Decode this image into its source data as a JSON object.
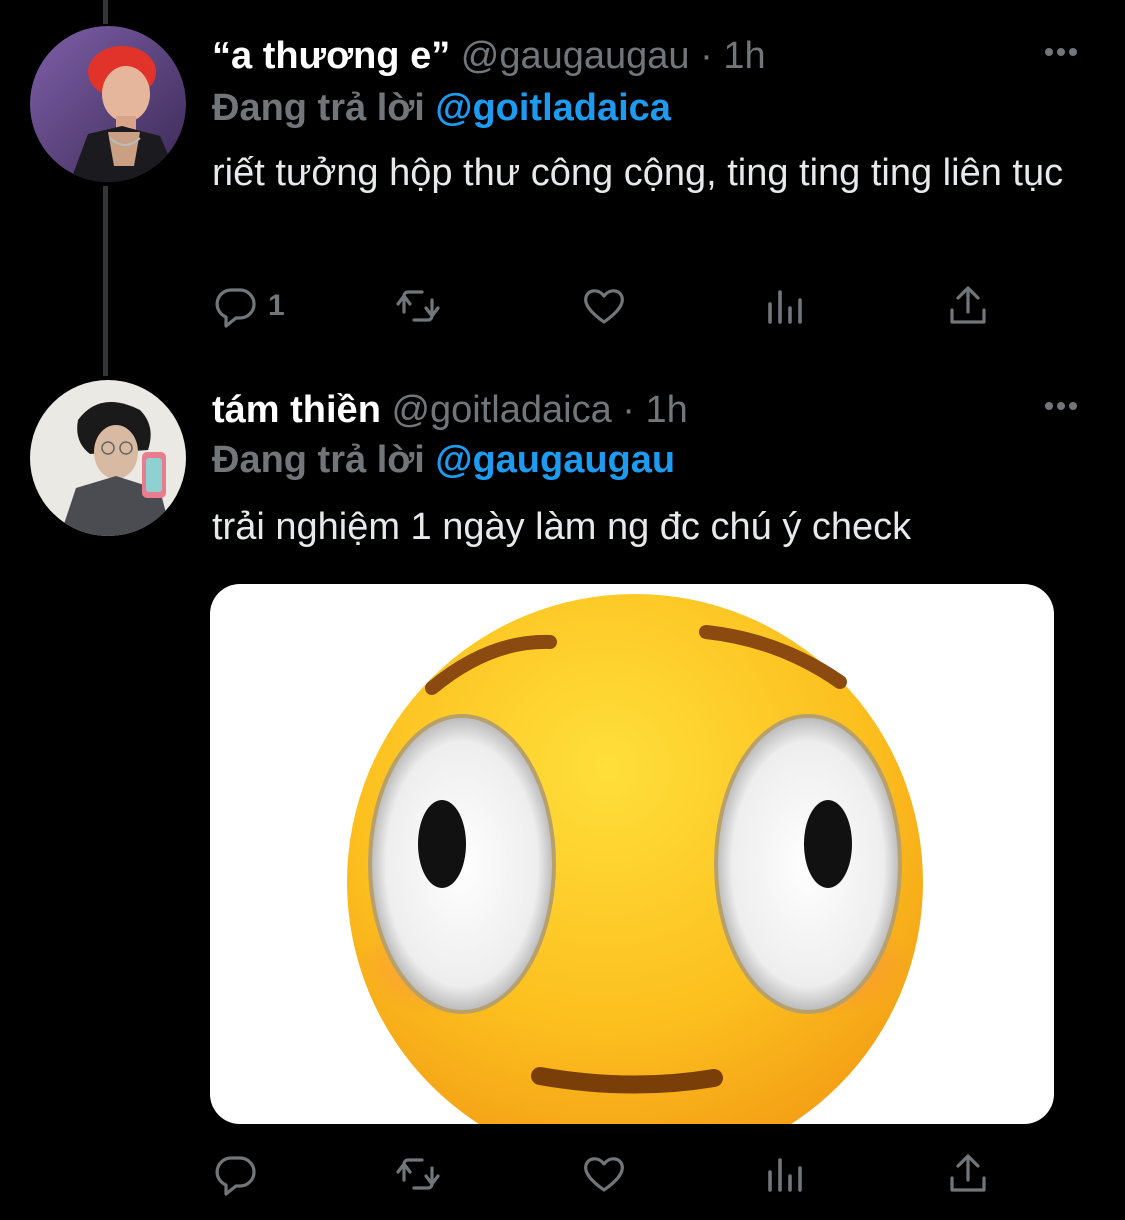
{
  "tweets": [
    {
      "display_name": "“a thương e”",
      "handle": "@gaugaugau",
      "separator": "·",
      "time": "1h",
      "reply_prefix": "Đang trả lời",
      "reply_to": "@goitladaica",
      "text": "riết tưởng hộp thư công cộng, ting ting ting liên tục",
      "reply_count": "1",
      "retweet_count": "",
      "like_count": "",
      "more_icon": "more-dots-icon"
    },
    {
      "display_name": "tám thiền",
      "handle": "@goitladaica",
      "separator": "·",
      "time": "1h",
      "reply_prefix": "Đang trả lời",
      "reply_to": "@gaugaugau",
      "text": "trải nghiệm 1 ngày làm ng đc chú ý check",
      "reply_count": "",
      "retweet_count": "",
      "like_count": "",
      "more_icon": "more-dots-icon"
    }
  ],
  "icons": {
    "reply": "reply-icon",
    "retweet": "retweet-icon",
    "like": "heart-icon",
    "views": "views-icon",
    "share": "share-icon"
  },
  "colors": {
    "background": "#000000",
    "secondary_text": "#71767b",
    "mention": "#1d9bf0",
    "thread_line": "#333639"
  }
}
